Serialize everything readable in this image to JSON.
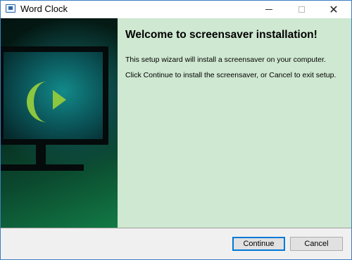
{
  "window": {
    "title": "Word Clock",
    "close_glyph": "✕"
  },
  "content": {
    "heading": "Welcome to screensaver installation!",
    "paragraph1": "This setup wizard will install a screensaver on your computer.",
    "paragraph2": "Click Continue to install the screensaver, or Cancel to exit setup."
  },
  "buttons": {
    "continue": "Continue",
    "cancel": "Cancel"
  },
  "colors": {
    "content_background": "#cfe8d1",
    "logo_green": "#8dc63f",
    "accent_blue": "#0078d7"
  },
  "icons": [
    "app-icon",
    "minimize-icon",
    "maximize-icon",
    "close-icon",
    "monitor-illustration",
    "crescent-logo-icon",
    "play-icon"
  ]
}
